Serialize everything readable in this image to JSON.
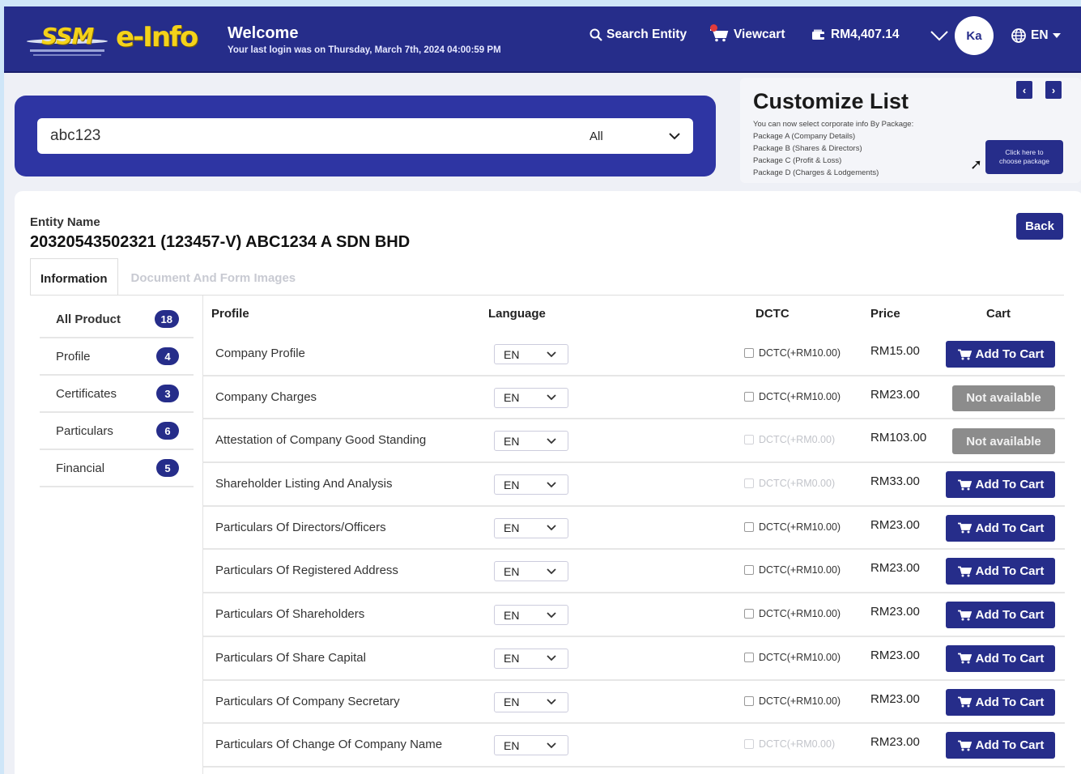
{
  "header": {
    "welcome_title": "Welcome",
    "last_login": "Your last login was on Thursday, March 7th, 2024 04:00:59 PM",
    "search_entity": "Search Entity",
    "viewcart": "Viewcart",
    "balance": "RM4,407.14",
    "avatar_initials": "Ka",
    "language": "EN",
    "brand_color": "#262d8a"
  },
  "search": {
    "value": "abc123",
    "scope": "All"
  },
  "customize": {
    "title": "Customize List",
    "intro": "You can now select corporate info By Package:",
    "packages": [
      "Package A (Company Details)",
      "Package B (Shares & Directors)",
      "Package C (Profit & Loss)",
      "Package D (Charges & Lodgements)"
    ],
    "button_line1": "Click here to",
    "button_line2": "choose package"
  },
  "entity": {
    "label": "Entity Name",
    "name": "20320543502321 (123457-V)  ABC1234 A SDN BHD",
    "back": "Back"
  },
  "tabs": [
    {
      "label": "Information"
    },
    {
      "label": "Document And Form Images"
    }
  ],
  "categories": [
    {
      "label": "All Product",
      "count": "18"
    },
    {
      "label": "Profile",
      "count": "4"
    },
    {
      "label": "Certificates",
      "count": "3"
    },
    {
      "label": "Particulars",
      "count": "6"
    },
    {
      "label": "Financial",
      "count": "5"
    }
  ],
  "table": {
    "headers": {
      "profile": "Profile",
      "language": "Language",
      "dctc": "DCTC",
      "price": "Price",
      "cart": "Cart"
    },
    "add_label": "Add To Cart",
    "na_label": "Not available",
    "rows": [
      {
        "name": "Company Profile",
        "lang": "EN",
        "dctc": "DCTC(+RM10.00)",
        "dctc_disabled": false,
        "price": "RM15.00",
        "available": true
      },
      {
        "name": "Company Charges",
        "lang": "EN",
        "dctc": "DCTC(+RM10.00)",
        "dctc_disabled": false,
        "price": "RM23.00",
        "available": false
      },
      {
        "name": "Attestation of Company Good Standing",
        "lang": "EN",
        "dctc": "DCTC(+RM0.00)",
        "dctc_disabled": true,
        "price": "RM103.00",
        "available": false
      },
      {
        "name": "Shareholder Listing And Analysis",
        "lang": "EN",
        "dctc": "DCTC(+RM0.00)",
        "dctc_disabled": true,
        "price": "RM33.00",
        "available": true
      },
      {
        "name": "Particulars Of Directors/Officers",
        "lang": "EN",
        "dctc": "DCTC(+RM10.00)",
        "dctc_disabled": false,
        "price": "RM23.00",
        "available": true
      },
      {
        "name": "Particulars Of Registered Address",
        "lang": "EN",
        "dctc": "DCTC(+RM10.00)",
        "dctc_disabled": false,
        "price": "RM23.00",
        "available": true
      },
      {
        "name": "Particulars Of Shareholders",
        "lang": "EN",
        "dctc": "DCTC(+RM10.00)",
        "dctc_disabled": false,
        "price": "RM23.00",
        "available": true
      },
      {
        "name": "Particulars Of Share Capital",
        "lang": "EN",
        "dctc": "DCTC(+RM10.00)",
        "dctc_disabled": false,
        "price": "RM23.00",
        "available": true
      },
      {
        "name": "Particulars Of Company Secretary",
        "lang": "EN",
        "dctc": "DCTC(+RM10.00)",
        "dctc_disabled": false,
        "price": "RM23.00",
        "available": true
      },
      {
        "name": "Particulars Of Change Of Company Name",
        "lang": "EN",
        "dctc": "DCTC(+RM0.00)",
        "dctc_disabled": true,
        "price": "RM23.00",
        "available": true
      }
    ]
  }
}
